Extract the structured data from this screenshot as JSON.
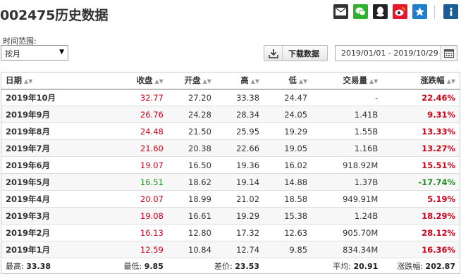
{
  "page_title": "002475历史数据",
  "share_icons": [
    "mail-icon",
    "wechat-icon",
    "qq-icon",
    "weibo-icon",
    "favorite-star-icon",
    "info-icon"
  ],
  "range_label": "时间范围:",
  "range_select": "按月",
  "download_label": "下载数据",
  "date_range": "2019/01/01 - 2019/10/29",
  "headers": [
    "日期",
    "收盘",
    "开盘",
    "高",
    "低",
    "交易量",
    "涨跌幅"
  ],
  "rows": [
    {
      "date": "2019年10月",
      "close": "32.77",
      "open": "27.20",
      "high": "33.38",
      "low": "24.47",
      "volume": "-",
      "change": "22.46%",
      "dir": "up"
    },
    {
      "date": "2019年9月",
      "close": "26.76",
      "open": "24.28",
      "high": "28.34",
      "low": "24.05",
      "volume": "1.41B",
      "change": "9.31%",
      "dir": "up"
    },
    {
      "date": "2019年8月",
      "close": "24.48",
      "open": "21.50",
      "high": "25.95",
      "low": "19.29",
      "volume": "1.55B",
      "change": "13.33%",
      "dir": "up"
    },
    {
      "date": "2019年7月",
      "close": "21.60",
      "open": "20.38",
      "high": "22.66",
      "low": "19.05",
      "volume": "1.16B",
      "change": "13.27%",
      "dir": "up"
    },
    {
      "date": "2019年6月",
      "close": "19.07",
      "open": "16.50",
      "high": "19.36",
      "low": "16.02",
      "volume": "918.92M",
      "change": "15.51%",
      "dir": "up"
    },
    {
      "date": "2019年5月",
      "close": "16.51",
      "open": "18.62",
      "high": "19.14",
      "low": "14.88",
      "volume": "1.37B",
      "change": "-17.74%",
      "dir": "down"
    },
    {
      "date": "2019年4月",
      "close": "20.07",
      "open": "18.99",
      "high": "21.02",
      "low": "18.58",
      "volume": "949.91M",
      "change": "5.19%",
      "dir": "up"
    },
    {
      "date": "2019年3月",
      "close": "19.08",
      "open": "16.61",
      "high": "19.29",
      "low": "15.38",
      "volume": "1.24B",
      "change": "18.29%",
      "dir": "up"
    },
    {
      "date": "2019年2月",
      "close": "16.13",
      "open": "12.80",
      "high": "17.32",
      "low": "12.63",
      "volume": "905.70M",
      "change": "28.12%",
      "dir": "up"
    },
    {
      "date": "2019年1月",
      "close": "12.59",
      "open": "10.84",
      "high": "12.74",
      "low": "9.85",
      "volume": "834.34M",
      "change": "16.36%",
      "dir": "up"
    }
  ],
  "summary": {
    "high_label": "最高:",
    "high": "33.38",
    "low_label": "最低:",
    "low": "9.85",
    "diff_label": "差价:",
    "diff": "23.53",
    "avg_label": "平均:",
    "avg": "20.91",
    "change_label": "涨跌幅:",
    "change": "202.87"
  },
  "colors": {
    "up": "#d0021b",
    "down": "#1e8e1e"
  }
}
